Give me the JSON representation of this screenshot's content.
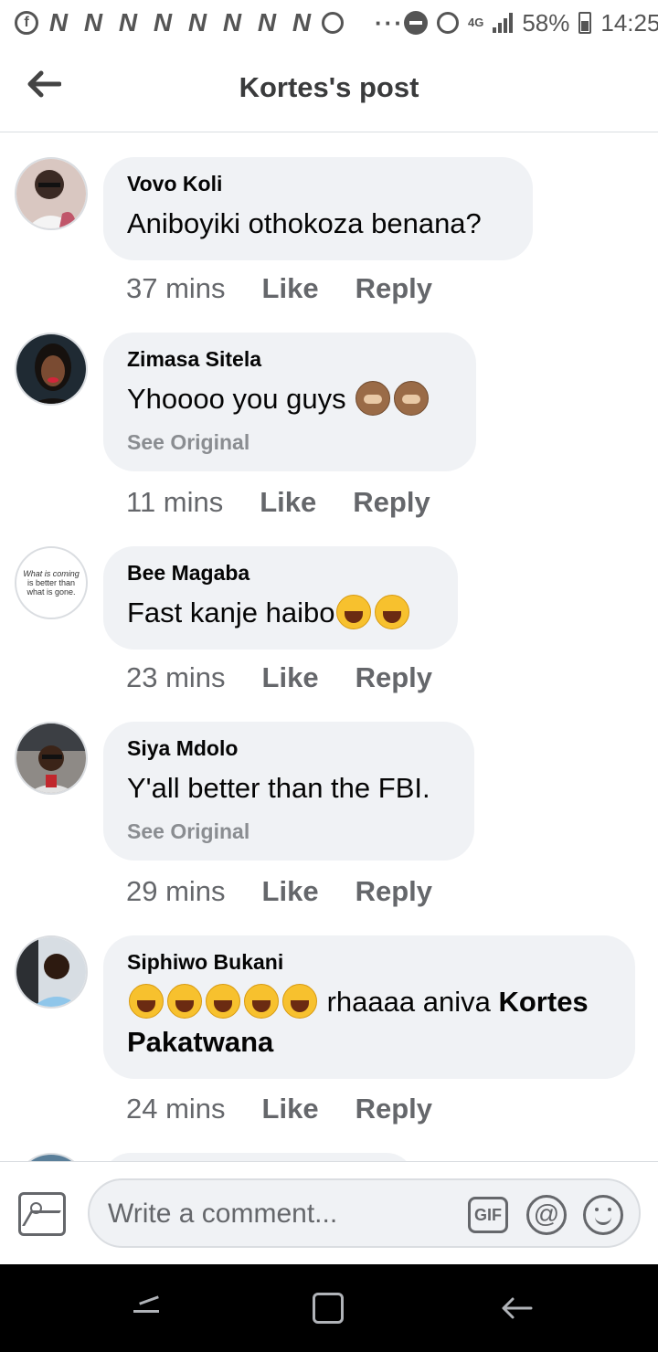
{
  "status_bar": {
    "facebook_icon": "f",
    "notification_icons": [
      "N",
      "N",
      "N",
      "N",
      "N",
      "N",
      "N",
      "N"
    ],
    "more": "···",
    "network": "4G",
    "battery": "58%",
    "time": "14:25"
  },
  "header": {
    "title": "Kortes's post",
    "back_icon": "arrow-left-icon"
  },
  "comments": [
    {
      "author": "Vovo Koli",
      "text": "Aniboyiki othokoza benana?",
      "see_original": "",
      "time": "37 mins",
      "like": "Like",
      "reply": "Reply"
    },
    {
      "author": "Zimasa Sitela",
      "text": "Yhoooo you guys ",
      "emoji": [
        "see-no-evil-monkey",
        "see-no-evil-monkey"
      ],
      "see_original": "See Original",
      "time": "11 mins",
      "like": "Like",
      "reply": "Reply"
    },
    {
      "author": "Bee Magaba",
      "text": "Fast kanje haibo",
      "emoji": [
        "joy-emoji",
        "rofl-emoji"
      ],
      "see_original": "",
      "time": "23 mins",
      "like": "Like",
      "reply": "Reply",
      "avatar_text": [
        "What is coming",
        "is better than",
        "what is gone."
      ]
    },
    {
      "author": "Siya Mdolo",
      "text": "Y'all better than the FBI.",
      "see_original": "See Original",
      "time": "29 mins",
      "like": "Like",
      "reply": "Reply"
    },
    {
      "author": "Siphiwo Bukani",
      "text_before": " rhaaaa aniva ",
      "mention": "Kortes Pakatwana",
      "emoji": [
        "rofl-emoji",
        "rofl-emoji",
        "rofl-emoji",
        "rofl-emoji",
        "rofl-emoji"
      ],
      "see_original": "",
      "time": "24 mins",
      "like": "Like",
      "reply": "Reply"
    }
  ],
  "composer": {
    "placeholder": "Write a comment...",
    "gif_label": "GIF",
    "at_label": "@"
  },
  "colors": {
    "bubble": "#f0f2f5",
    "secondary_text": "#65676b",
    "navbar": "#000000"
  }
}
